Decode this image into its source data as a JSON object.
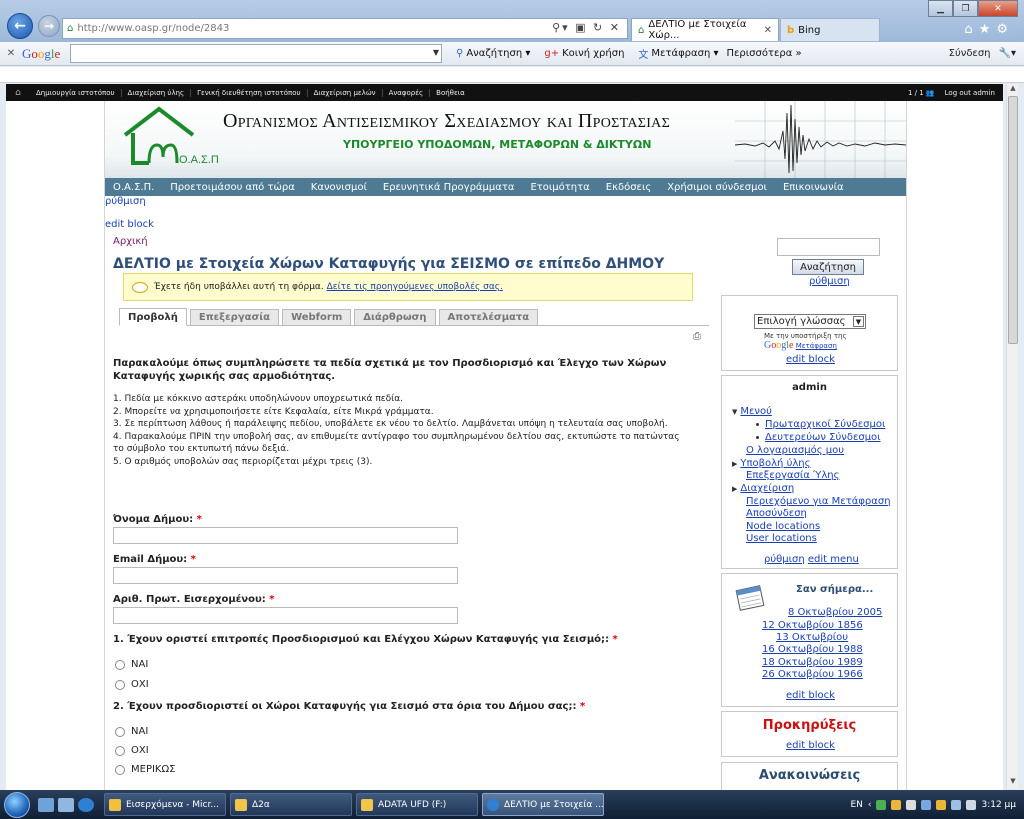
{
  "browser": {
    "url": "http://www.oasp.gr/node/2843",
    "active_tab": "ΔΕΛΤΙΟ με Στοιχεία Χώρ...",
    "other_tab": "Bing"
  },
  "google_toolbar": {
    "logo": "Google",
    "search": "Αναζήτηση",
    "share": "Κοινή χρήση",
    "translate": "Μετάφραση",
    "more": "Περισσότερα »",
    "signin": "Σύνδεση"
  },
  "admin_menu": {
    "items": [
      "Δημιουργία ιστοτόπου",
      "Διαχείριση ύλης",
      "Γενική διευθέτηση ιστοτόπου",
      "Διαχείριση μελών",
      "Αναφορές",
      "Βοήθεια"
    ],
    "counter": "1 / 1",
    "logout": "Log out admin"
  },
  "header": {
    "title": "Οργανισμος Αντισεισμικου Σχεδιασμου και Προστασιας",
    "subtitle": "ΥΠΟΥΡΓΕΙΟ ΥΠΟΔΟΜΩΝ, ΜΕΤΑΦΟΡΩΝ & ΔΙΚΤΥΩΝ",
    "logo_text": "Ο.Α.Σ.Π."
  },
  "nav": [
    "Ο.Α.Σ.Π.",
    "Προετοιμάσου από τώρα",
    "Κανονισμοί",
    "Ερευνητικά Προγράμματα",
    "Ετοιμότητα",
    "Εκδόσεις",
    "Χρήσιμοι σύνδεσμοι",
    "Επικοινωνία"
  ],
  "links": {
    "rythmisi": "ρύθμιση",
    "edit_block": "edit block",
    "edit_menu": "edit menu"
  },
  "breadcrumb": "Αρχική",
  "page_title": "ΔΕΛΤΙΟ με Στοιχεία Χώρων Καταφυγής για ΣΕΙΣΜΟ σε επίπεδο ΔΗΜΟΥ",
  "notice": {
    "text": "Έχετε ήδη υποβάλλει αυτή τη φόρμα.",
    "link": "Δείτε τις προηγούμενες υποβολές σας."
  },
  "tabs": [
    "Προβολή",
    "Επεξεργασία",
    "Webform",
    "Διάρθρωση",
    "Αποτελέσματα"
  ],
  "intro": "Παρακαλούμε όπως συμπληρώσετε τα πεδία σχετικά με τον Προσδιορισμό και Έλεγχο των Χώρων Καταφυγής χωρικής σας αρμοδιότητας.",
  "rules": [
    "1. Πεδία με κόκκινο αστεράκι υποδηλώνουν υποχρεωτικά πεδία.",
    "2. Μπορείτε να χρησιμοποιήσετε είτε Κεφαλαία, είτε Μικρά γράμματα.",
    "3. Σε περίπτωση λάθους ή παράλειψης πεδίου, υποβάλετε εκ νέου το δελτίο. Λαμβάνεται υπόψη η τελευταία σας υποβολή.",
    "4. Παρακαλούμε ΠΡΙΝ την υποβολή σας, αν επιθυμείτε αντίγραφο του συμπληρωμένου δελτίου σας, εκτυπώστε το πατώντας το σύμβολο του εκτυπωτή πάνω δεξιά.",
    "5. Ο αριθμός υποβολών σας περιορίζεται μέχρι τρεις (3)."
  ],
  "form": {
    "field1": "Όνομα Δήμου:",
    "field2": "Email Δήμου:",
    "field3": "Αριθ. Πρωτ. Εισερχομένου:",
    "required": "*",
    "q1": "1. Έχουν οριστεί επιτροπές Προσδιορισμού και Ελέγχου Χώρων Καταφυγής για Σεισμό;:",
    "q2": "2. Έχουν προσδιοριστεί οι Χώροι Καταφυγής για Σεισμό στα όρια του Δήμου σας;:",
    "yes": "ΝΑΙ",
    "no": "ΟΧΙ",
    "partly": "ΜΕΡΙΚΩΣ"
  },
  "sidebar": {
    "search_button": "Αναζήτηση",
    "language_select": "Επιλογή γλώσσας",
    "powered_by": "Με την υποστήριξη της",
    "google_translate": "Μετάφραση",
    "admin_title": "admin",
    "menu": "Μενού",
    "primary_links": "Πρωταρχικοί Σύνδεσμοι",
    "secondary_links": "Δευτερεύων Σύνδεσμοι",
    "account": "Ο λογαριασμός μου",
    "submit_content": "Υποβολή ύλης",
    "edit_content": "Επεξεργασία Ύλης",
    "administer": "Διαχείριση",
    "translate_content": "Περιεχόμενο για Μετάφραση",
    "logout": "Αποσύνδεση",
    "node_locations": "Node locations",
    "user_locations": "User locations",
    "today_title": "Σαν σήμερα...",
    "today_dates": [
      "8 Οκτωβρίου 2005",
      "12 Οκτωβρίου 1856",
      "13 Οκτωβρίου",
      "16 Οκτωβρίου 1988",
      "18 Οκτωβρίου 1989",
      "26 Οκτωβρίου 1966"
    ],
    "proclamations": "Προκηρύξεις",
    "announcements": "Ανακοινώσεις"
  },
  "taskbar": {
    "items": [
      "Εισερχόμενα - Micr...",
      "Δ2α",
      "ADATA UFD (F:)",
      "ΔΕΛΤΙΟ με Στοιχεία ..."
    ],
    "lang": "EN",
    "time": "3:12 μμ"
  }
}
